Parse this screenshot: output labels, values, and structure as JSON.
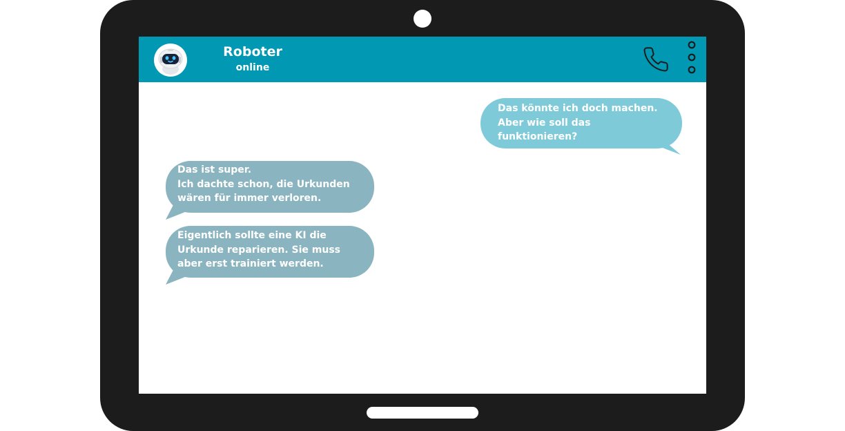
{
  "contact": {
    "name": "Roboter",
    "status": "online",
    "avatar_icon": "robot-icon"
  },
  "header": {
    "color": "#0198b4",
    "call_icon": "phone-icon",
    "menu_icon": "more-vertical-icon"
  },
  "messages": [
    {
      "direction": "outgoing",
      "color": "#7ecad9",
      "text": "Das könnte ich doch machen.\nAber wie soll das\nfunktionieren?"
    },
    {
      "direction": "incoming",
      "color": "#8ab4bf",
      "text": "Das ist super.\nIch dachte schon, die Urkunden\nwären für immer verloren."
    },
    {
      "direction": "incoming",
      "color": "#8ab4bf",
      "text": "Eigentlich sollte eine KI die\nUrkunde reparieren. Sie muss\naber erst trainiert werden."
    }
  ]
}
